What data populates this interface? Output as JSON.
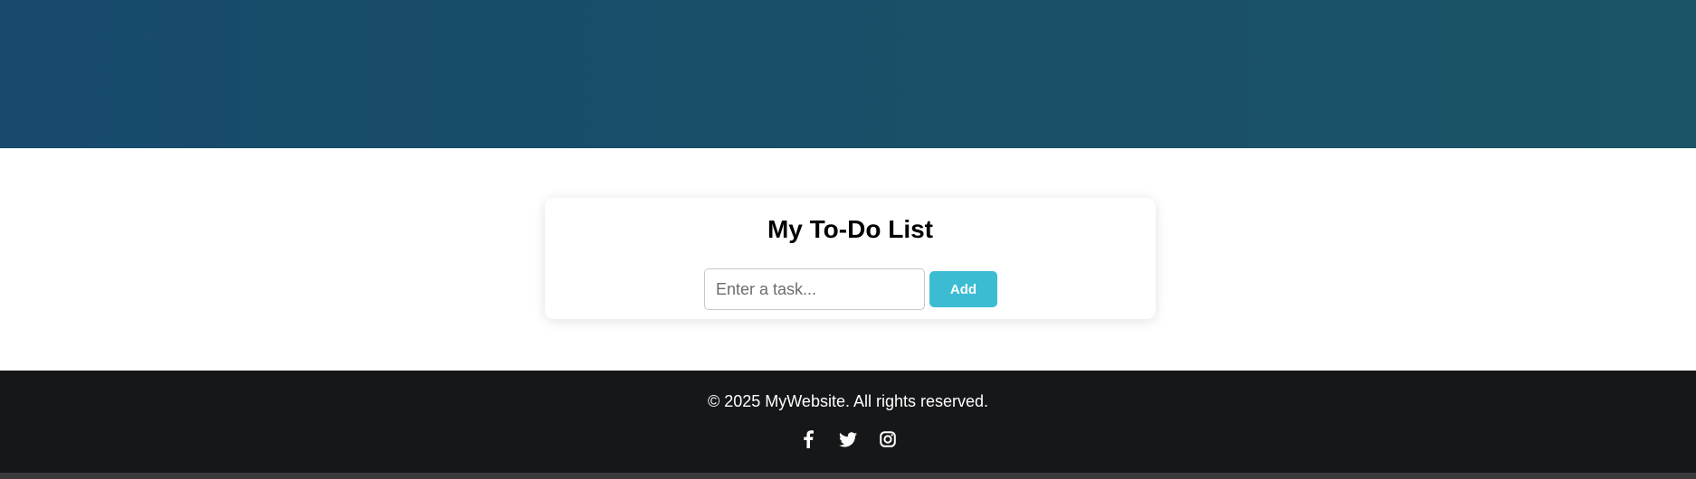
{
  "header": {
    "colors": {
      "start": "#174a6c",
      "end": "#1a5466"
    }
  },
  "todo": {
    "title": "My To-Do List",
    "input": {
      "placeholder": "Enter a task...",
      "value": ""
    },
    "add_label": "Add",
    "accent_color": "#3bbcd3"
  },
  "footer": {
    "copyright": "© 2025 MyWebsite. All rights reserved.",
    "background": "#161719",
    "social": [
      {
        "icon": "facebook-icon"
      },
      {
        "icon": "twitter-icon"
      },
      {
        "icon": "instagram-icon"
      }
    ]
  }
}
